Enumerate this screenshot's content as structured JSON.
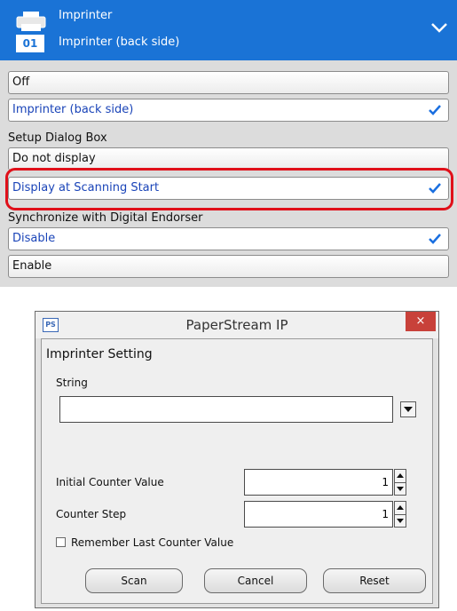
{
  "header": {
    "title": "Imprinter",
    "subtitle": "Imprinter (back side)",
    "badge": "01",
    "icon": "printer-icon",
    "expand_icon": "chevron-down-icon"
  },
  "imprinter_options": [
    {
      "label": "Off",
      "selected": false
    },
    {
      "label": "Imprinter (back side)",
      "selected": true
    }
  ],
  "setup_dialog": {
    "label": "Setup Dialog Box",
    "options": [
      {
        "label": "Do not display",
        "selected": false
      },
      {
        "label": "Display at Scanning Start",
        "selected": true,
        "highlighted": true
      }
    ]
  },
  "digital_endorser": {
    "label": "Synchronize with Digital Endorser",
    "options": [
      {
        "label": "Disable",
        "selected": true
      },
      {
        "label": "Enable",
        "selected": false
      }
    ]
  },
  "dialog": {
    "app_icon": "PS",
    "title": "PaperStream IP",
    "close_label": "×",
    "heading": "Imprinter Setting",
    "string_label": "String",
    "string_value": "",
    "initial_counter_label": "Initial Counter Value",
    "initial_counter_value": "1",
    "counter_step_label": "Counter Step",
    "counter_step_value": "1",
    "remember_label": "Remember Last Counter Value",
    "remember_checked": false,
    "buttons": {
      "scan": "Scan",
      "cancel": "Cancel",
      "reset": "Reset"
    }
  },
  "colors": {
    "header_blue": "#1a73d6",
    "selected_text": "#1a44b8",
    "highlight_red": "#e0101a",
    "close_red": "#c8413a"
  }
}
